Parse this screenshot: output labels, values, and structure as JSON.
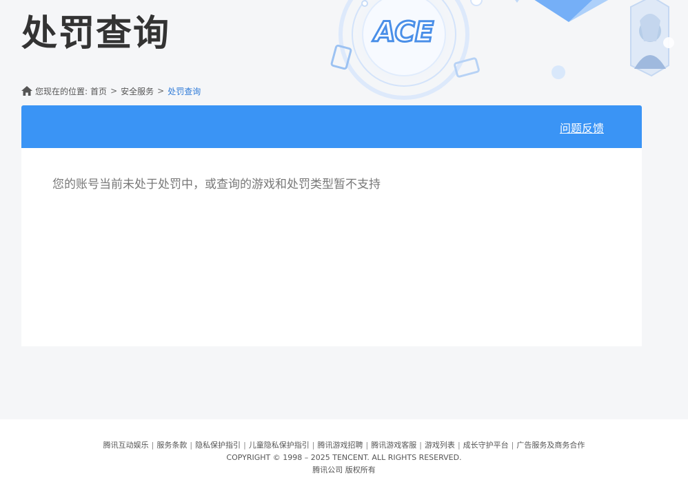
{
  "header": {
    "title": "处罚查询",
    "logo_text": "ACE"
  },
  "breadcrumb": {
    "prefix": "您现在的位置:",
    "items": [
      {
        "label": "首页"
      },
      {
        "label": "安全服务"
      }
    ],
    "current": "处罚查询",
    "separator": ">"
  },
  "panel": {
    "feedback_label": "问题反馈",
    "message": "您的账号当前未处于处罚中，或查询的游戏和处罚类型暂不支持"
  },
  "footer": {
    "links": [
      {
        "label": "腾讯互动娱乐"
      },
      {
        "label": "服务条款"
      },
      {
        "label": "隐私保护指引"
      },
      {
        "label": "儿童隐私保护指引"
      },
      {
        "label": "腾讯游戏招聘"
      },
      {
        "label": "腾讯游戏客服"
      },
      {
        "label": "游戏列表"
      },
      {
        "label": "成长守护平台"
      },
      {
        "label": "广告服务及商务合作"
      }
    ],
    "link_divider": "|",
    "copyright": "COPYRIGHT © 1998 – 2025 TENCENT. ALL RIGHTS RESERVED.",
    "company": "腾讯公司 版权所有"
  },
  "colors": {
    "accent": "#3a94f5",
    "breadcrumb_current": "#2f7bd8",
    "title": "#333333"
  }
}
